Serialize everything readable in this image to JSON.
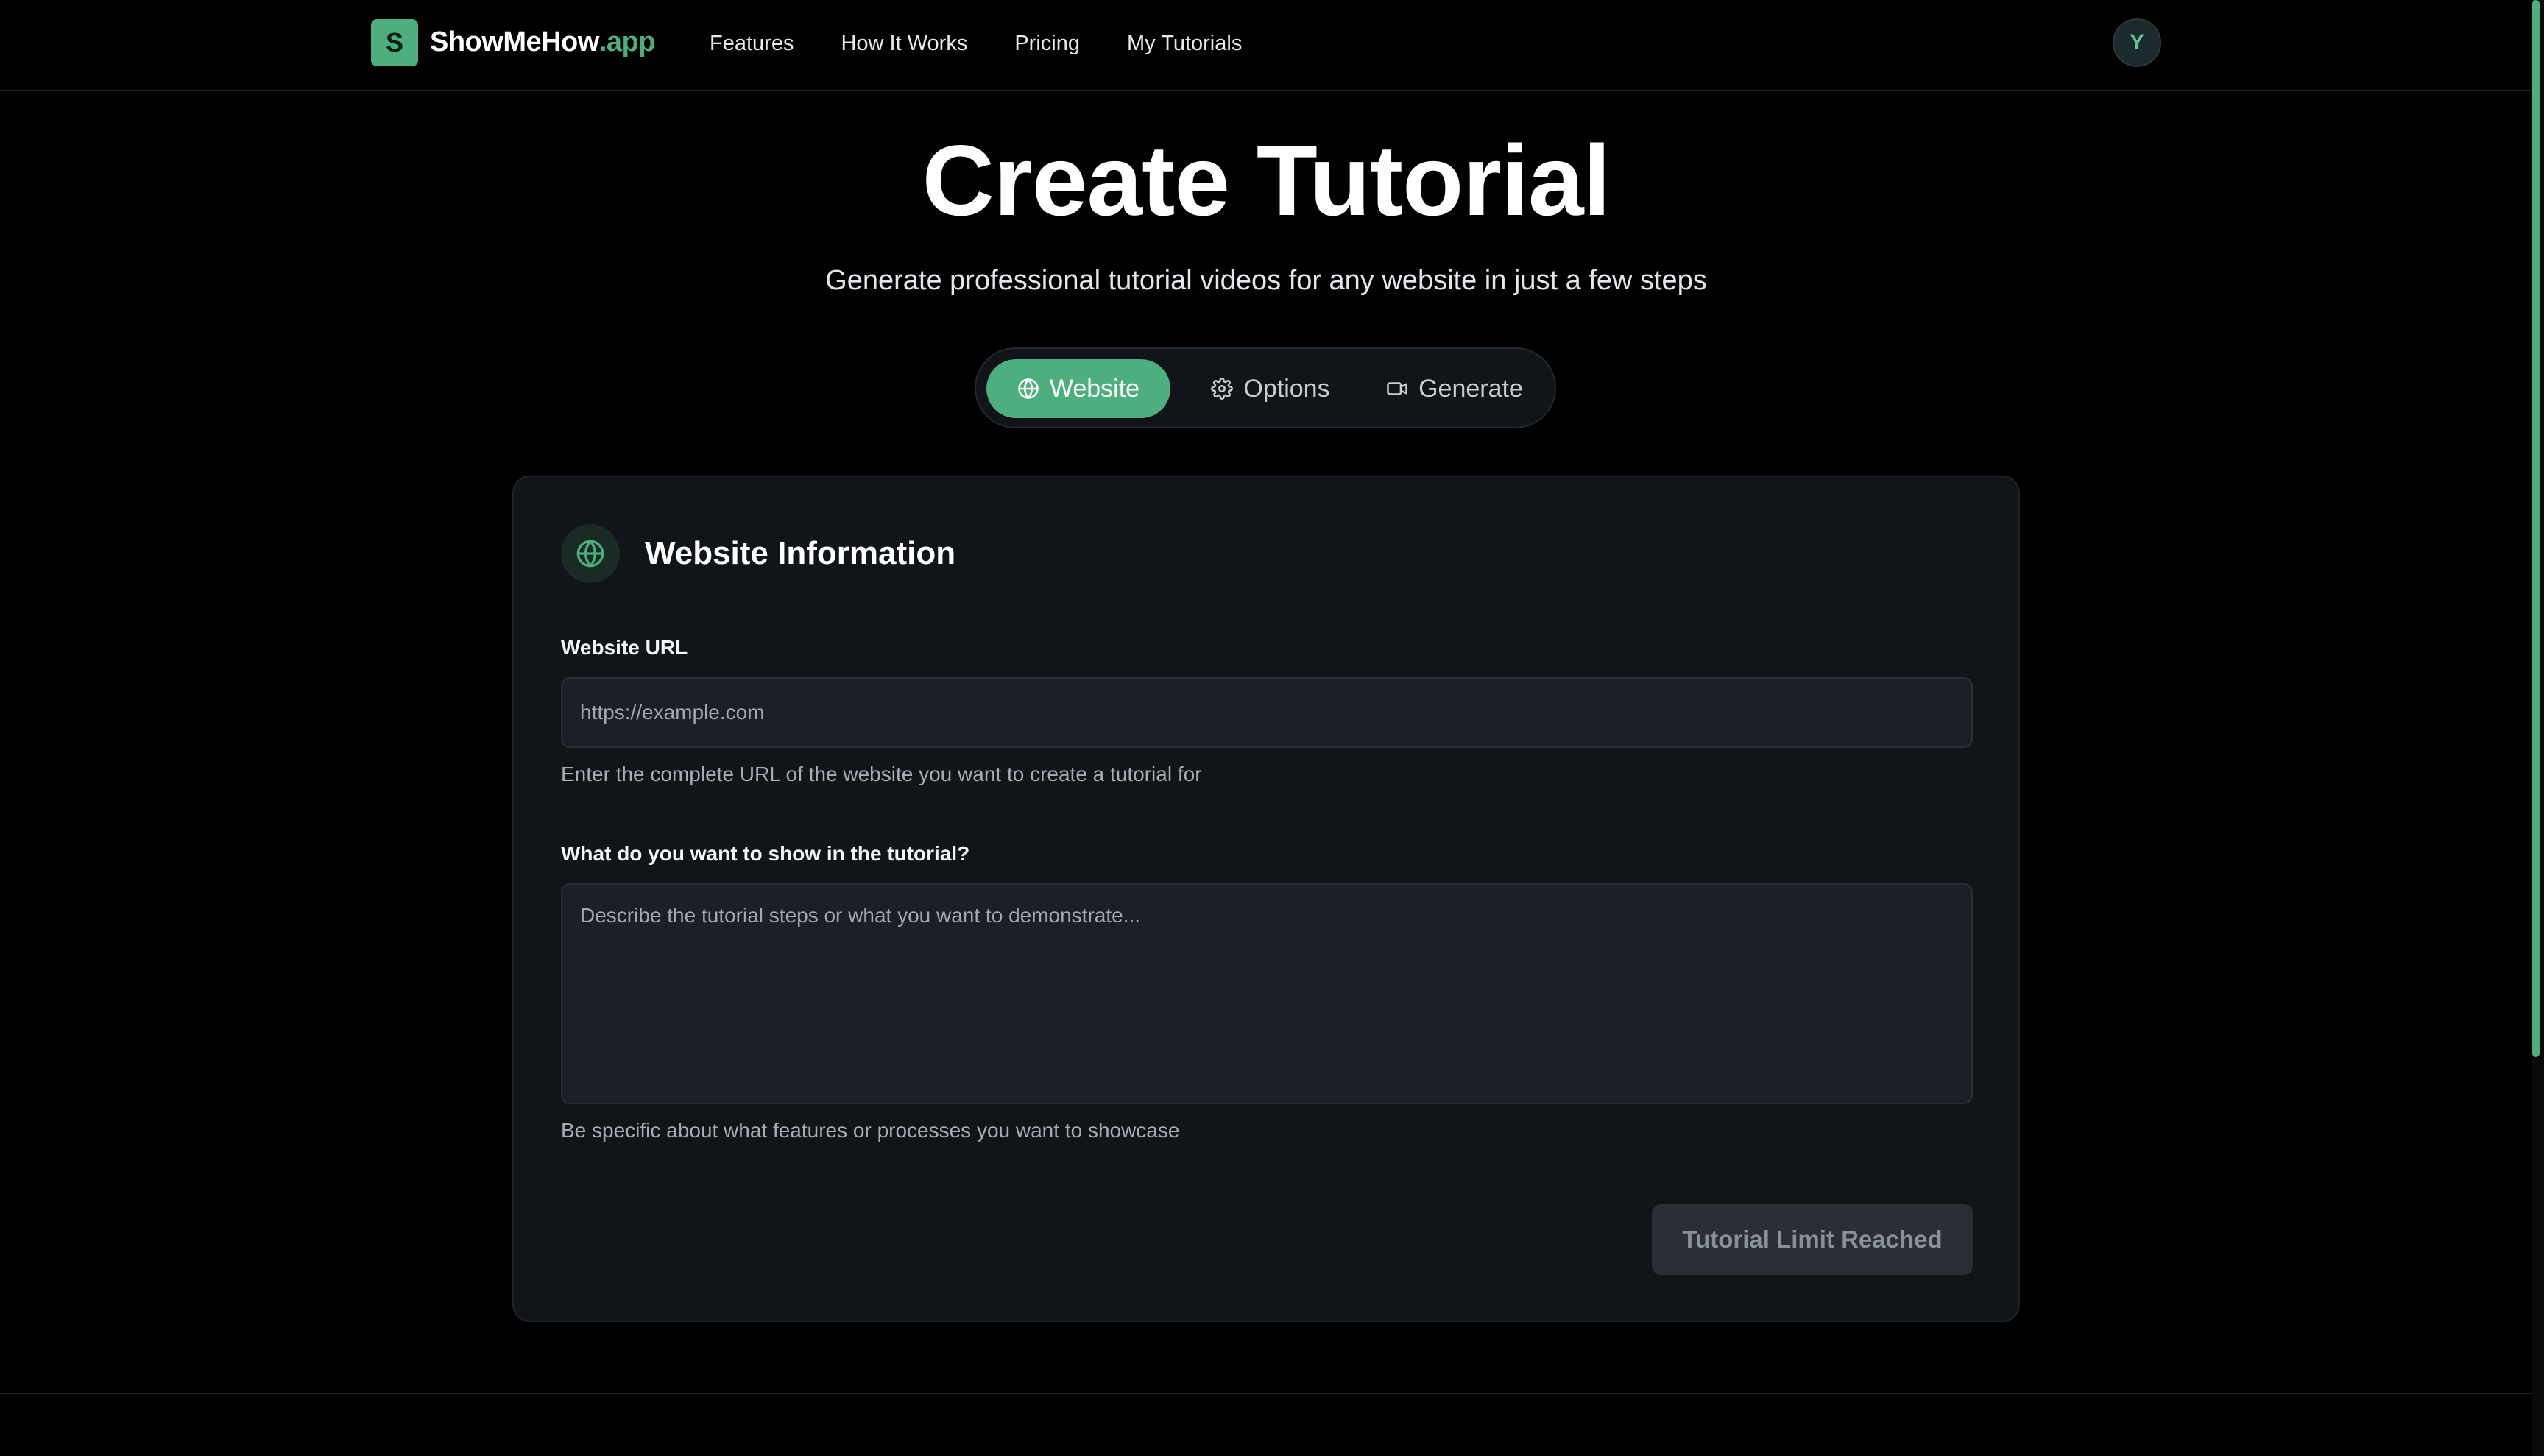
{
  "brand": {
    "mark": "S",
    "name_main": "ShowMeHow",
    "name_accent": ".app",
    "accent_color": "#4caf7d"
  },
  "nav": {
    "items": [
      {
        "label": "Features"
      },
      {
        "label": "How It Works"
      },
      {
        "label": "Pricing"
      },
      {
        "label": "My Tutorials"
      }
    ]
  },
  "user": {
    "avatar_initial": "Y"
  },
  "hero": {
    "title": "Create Tutorial",
    "subtitle": "Generate professional tutorial videos for any website in just a few steps"
  },
  "stepper": {
    "steps": [
      {
        "label": "Website",
        "icon": "globe-icon",
        "active": true
      },
      {
        "label": "Options",
        "icon": "gear-icon",
        "active": false
      },
      {
        "label": "Generate",
        "icon": "video-camera-icon",
        "active": false
      }
    ]
  },
  "card": {
    "icon": "globe-icon",
    "title": "Website Information",
    "url_field": {
      "label": "Website URL",
      "value": "",
      "placeholder": "https://example.com",
      "hint": "Enter the complete URL of the website you want to create a tutorial for"
    },
    "description_field": {
      "label": "What do you want to show in the tutorial?",
      "value": "",
      "placeholder": "Describe the tutorial steps or what you want to demonstrate...",
      "hint": "Be specific about what features or processes you want to showcase"
    },
    "submit_label": "Tutorial Limit Reached"
  }
}
